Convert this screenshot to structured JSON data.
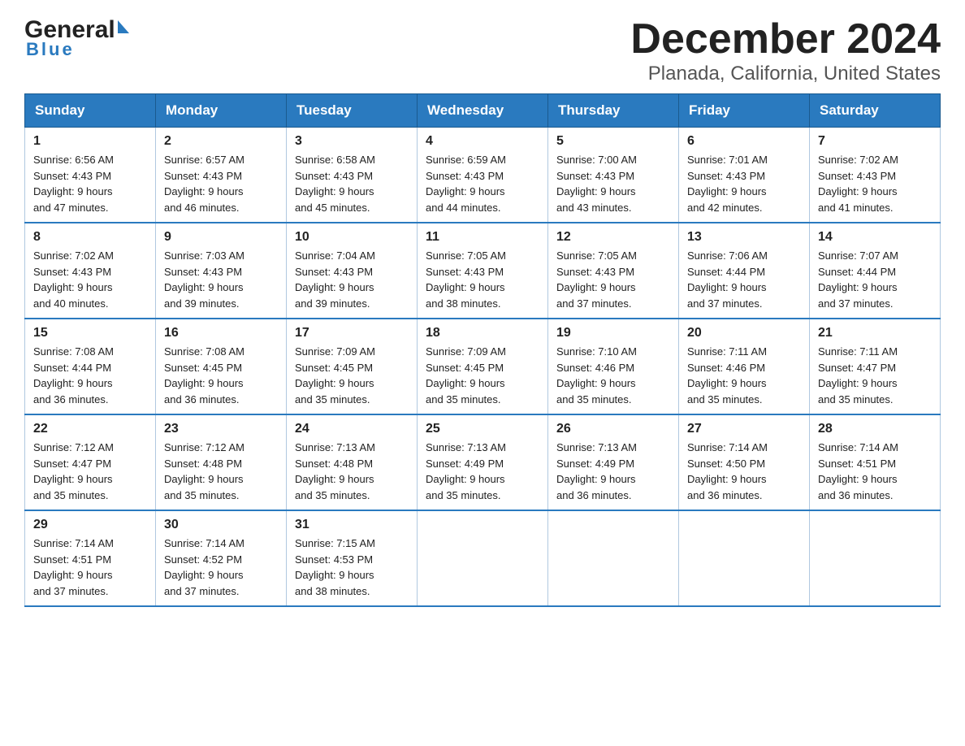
{
  "logo": {
    "general": "General",
    "blue": "Blue"
  },
  "title": "December 2024",
  "subtitle": "Planada, California, United States",
  "weekdays": [
    "Sunday",
    "Monday",
    "Tuesday",
    "Wednesday",
    "Thursday",
    "Friday",
    "Saturday"
  ],
  "weeks": [
    [
      {
        "day": "1",
        "sunrise": "6:56 AM",
        "sunset": "4:43 PM",
        "daylight": "9 hours and 47 minutes."
      },
      {
        "day": "2",
        "sunrise": "6:57 AM",
        "sunset": "4:43 PM",
        "daylight": "9 hours and 46 minutes."
      },
      {
        "day": "3",
        "sunrise": "6:58 AM",
        "sunset": "4:43 PM",
        "daylight": "9 hours and 45 minutes."
      },
      {
        "day": "4",
        "sunrise": "6:59 AM",
        "sunset": "4:43 PM",
        "daylight": "9 hours and 44 minutes."
      },
      {
        "day": "5",
        "sunrise": "7:00 AM",
        "sunset": "4:43 PM",
        "daylight": "9 hours and 43 minutes."
      },
      {
        "day": "6",
        "sunrise": "7:01 AM",
        "sunset": "4:43 PM",
        "daylight": "9 hours and 42 minutes."
      },
      {
        "day": "7",
        "sunrise": "7:02 AM",
        "sunset": "4:43 PM",
        "daylight": "9 hours and 41 minutes."
      }
    ],
    [
      {
        "day": "8",
        "sunrise": "7:02 AM",
        "sunset": "4:43 PM",
        "daylight": "9 hours and 40 minutes."
      },
      {
        "day": "9",
        "sunrise": "7:03 AM",
        "sunset": "4:43 PM",
        "daylight": "9 hours and 39 minutes."
      },
      {
        "day": "10",
        "sunrise": "7:04 AM",
        "sunset": "4:43 PM",
        "daylight": "9 hours and 39 minutes."
      },
      {
        "day": "11",
        "sunrise": "7:05 AM",
        "sunset": "4:43 PM",
        "daylight": "9 hours and 38 minutes."
      },
      {
        "day": "12",
        "sunrise": "7:05 AM",
        "sunset": "4:43 PM",
        "daylight": "9 hours and 37 minutes."
      },
      {
        "day": "13",
        "sunrise": "7:06 AM",
        "sunset": "4:44 PM",
        "daylight": "9 hours and 37 minutes."
      },
      {
        "day": "14",
        "sunrise": "7:07 AM",
        "sunset": "4:44 PM",
        "daylight": "9 hours and 37 minutes."
      }
    ],
    [
      {
        "day": "15",
        "sunrise": "7:08 AM",
        "sunset": "4:44 PM",
        "daylight": "9 hours and 36 minutes."
      },
      {
        "day": "16",
        "sunrise": "7:08 AM",
        "sunset": "4:45 PM",
        "daylight": "9 hours and 36 minutes."
      },
      {
        "day": "17",
        "sunrise": "7:09 AM",
        "sunset": "4:45 PM",
        "daylight": "9 hours and 35 minutes."
      },
      {
        "day": "18",
        "sunrise": "7:09 AM",
        "sunset": "4:45 PM",
        "daylight": "9 hours and 35 minutes."
      },
      {
        "day": "19",
        "sunrise": "7:10 AM",
        "sunset": "4:46 PM",
        "daylight": "9 hours and 35 minutes."
      },
      {
        "day": "20",
        "sunrise": "7:11 AM",
        "sunset": "4:46 PM",
        "daylight": "9 hours and 35 minutes."
      },
      {
        "day": "21",
        "sunrise": "7:11 AM",
        "sunset": "4:47 PM",
        "daylight": "9 hours and 35 minutes."
      }
    ],
    [
      {
        "day": "22",
        "sunrise": "7:12 AM",
        "sunset": "4:47 PM",
        "daylight": "9 hours and 35 minutes."
      },
      {
        "day": "23",
        "sunrise": "7:12 AM",
        "sunset": "4:48 PM",
        "daylight": "9 hours and 35 minutes."
      },
      {
        "day": "24",
        "sunrise": "7:13 AM",
        "sunset": "4:48 PM",
        "daylight": "9 hours and 35 minutes."
      },
      {
        "day": "25",
        "sunrise": "7:13 AM",
        "sunset": "4:49 PM",
        "daylight": "9 hours and 35 minutes."
      },
      {
        "day": "26",
        "sunrise": "7:13 AM",
        "sunset": "4:49 PM",
        "daylight": "9 hours and 36 minutes."
      },
      {
        "day": "27",
        "sunrise": "7:14 AM",
        "sunset": "4:50 PM",
        "daylight": "9 hours and 36 minutes."
      },
      {
        "day": "28",
        "sunrise": "7:14 AM",
        "sunset": "4:51 PM",
        "daylight": "9 hours and 36 minutes."
      }
    ],
    [
      {
        "day": "29",
        "sunrise": "7:14 AM",
        "sunset": "4:51 PM",
        "daylight": "9 hours and 37 minutes."
      },
      {
        "day": "30",
        "sunrise": "7:14 AM",
        "sunset": "4:52 PM",
        "daylight": "9 hours and 37 minutes."
      },
      {
        "day": "31",
        "sunrise": "7:15 AM",
        "sunset": "4:53 PM",
        "daylight": "9 hours and 38 minutes."
      },
      null,
      null,
      null,
      null
    ]
  ],
  "labels": {
    "sunrise": "Sunrise:",
    "sunset": "Sunset:",
    "daylight": "Daylight:"
  }
}
